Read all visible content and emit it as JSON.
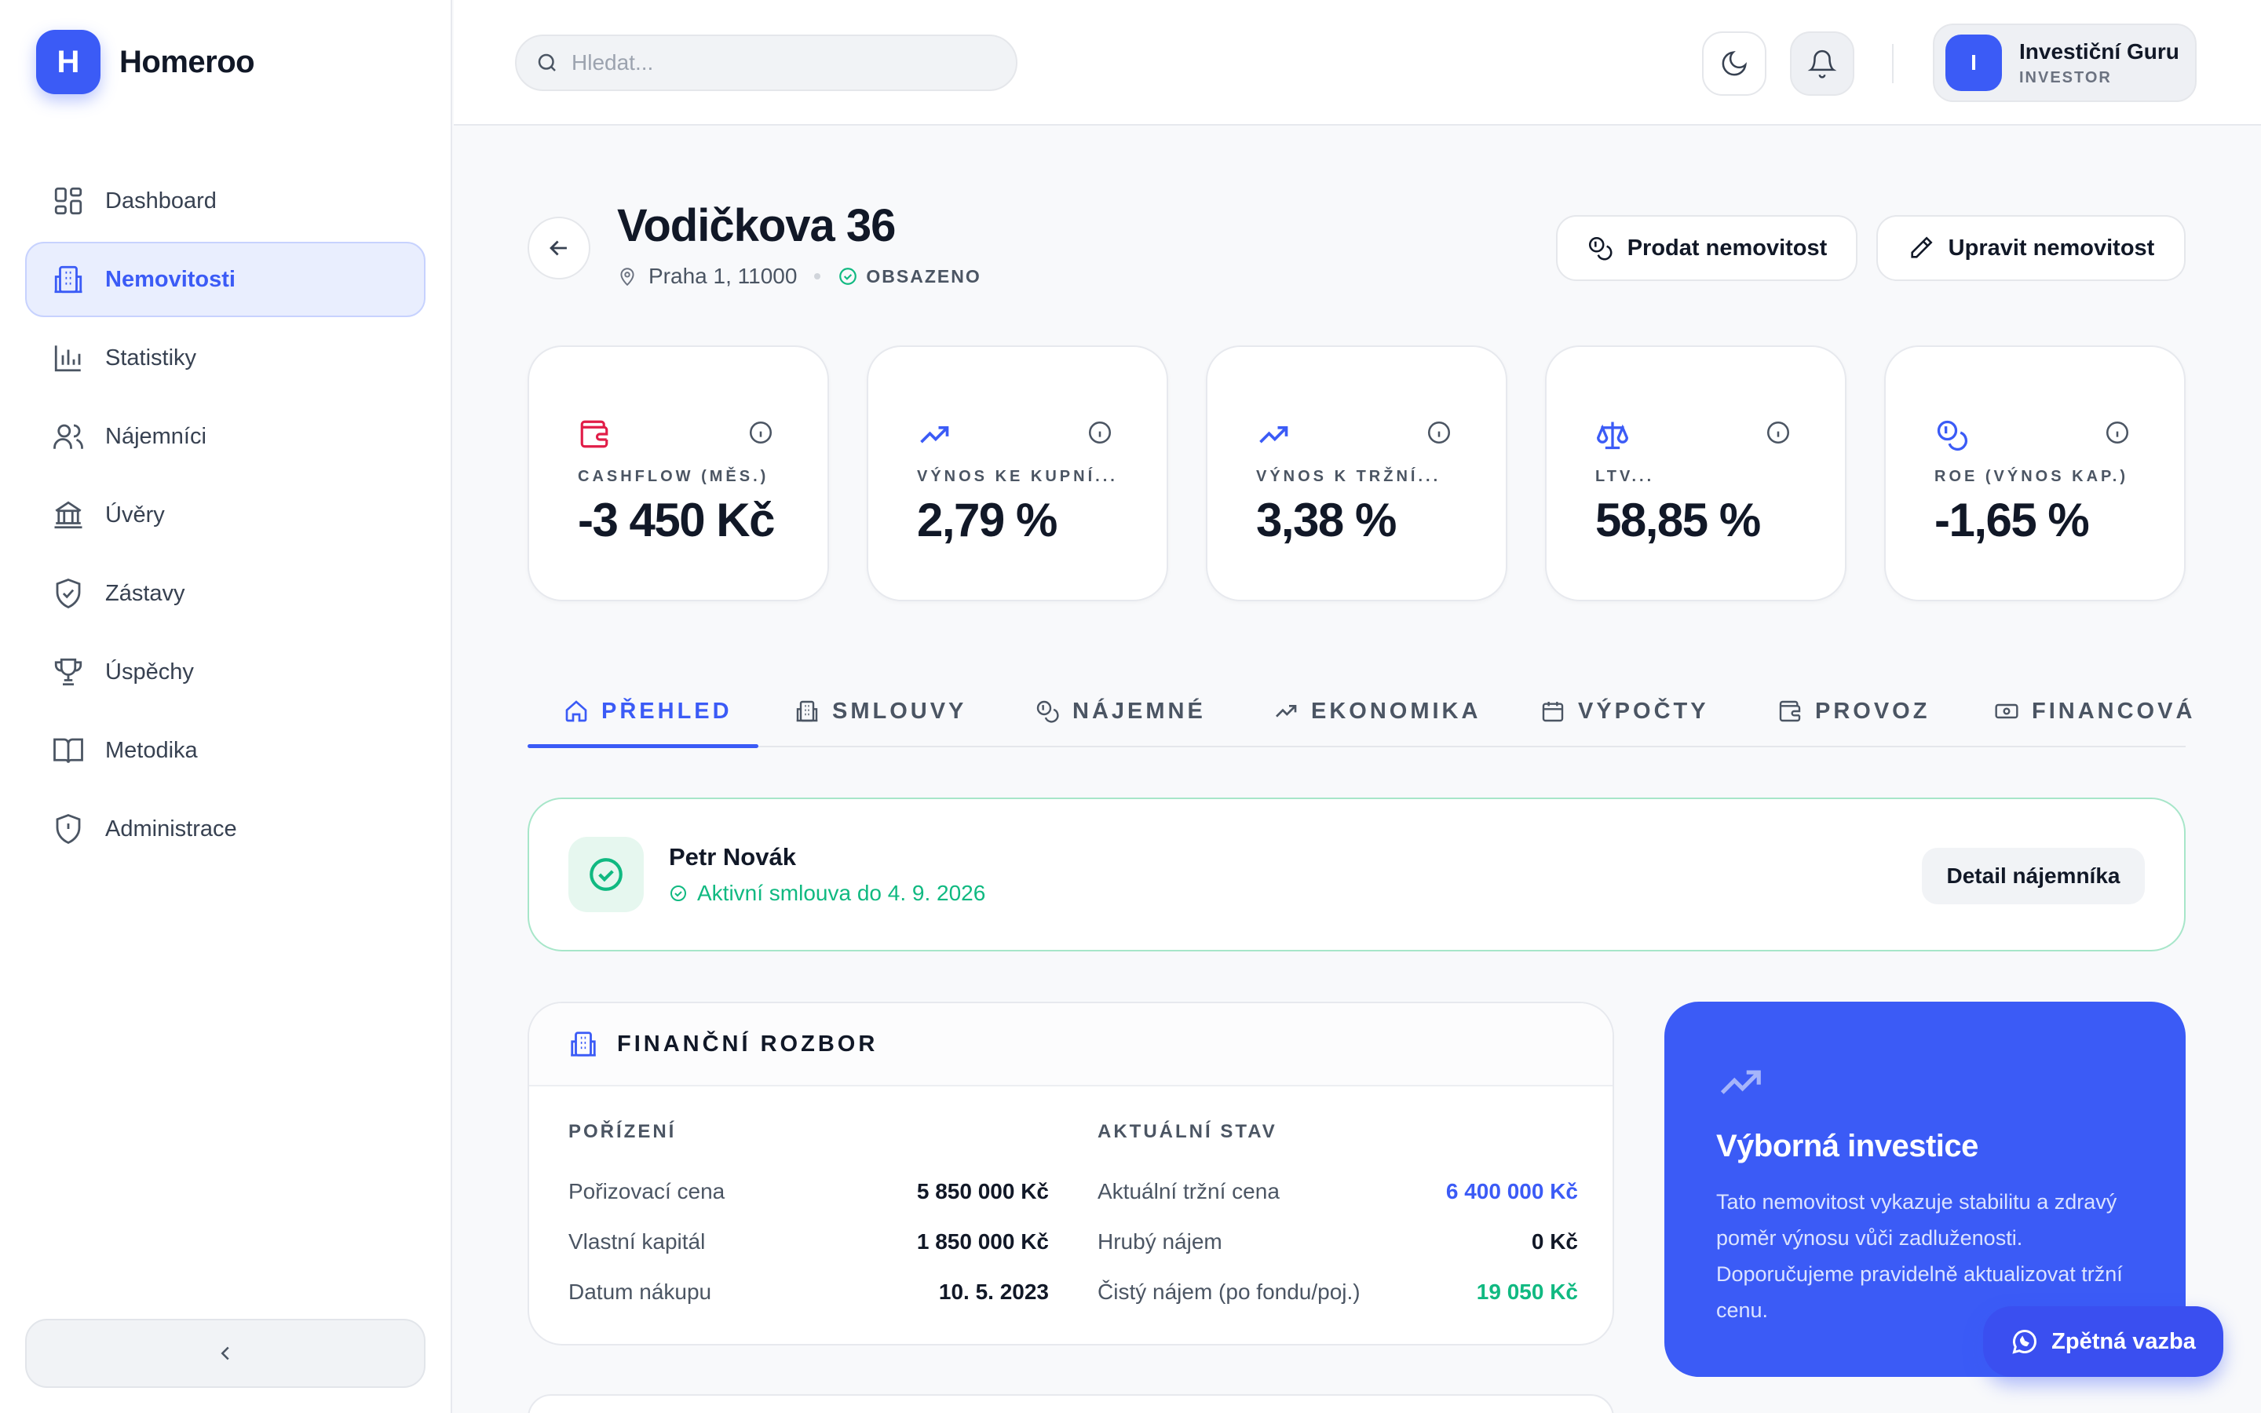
{
  "brand": {
    "logo_letter": "H",
    "name": "Homeroo"
  },
  "colors": {
    "accent": "#3b5bf6",
    "success": "#10b981",
    "danger": "#e11d48"
  },
  "sidebar": {
    "items": [
      {
        "label": "Dashboard",
        "icon": "grid-icon"
      },
      {
        "label": "Nemovitosti",
        "icon": "building-icon",
        "active": true
      },
      {
        "label": "Statistiky",
        "icon": "bar-chart-icon"
      },
      {
        "label": "Nájemníci",
        "icon": "users-icon"
      },
      {
        "label": "Úvěry",
        "icon": "bank-icon"
      },
      {
        "label": "Zástavy",
        "icon": "shield-check-icon"
      },
      {
        "label": "Úspěchy",
        "icon": "trophy-icon"
      },
      {
        "label": "Metodika",
        "icon": "book-icon"
      },
      {
        "label": "Administrace",
        "icon": "shield-alert-icon"
      }
    ]
  },
  "header": {
    "search_placeholder": "Hledat...",
    "user": {
      "initial": "I",
      "name": "Investiční Guru",
      "role": "INVESTOR"
    }
  },
  "property": {
    "title": "Vodičkova 36",
    "address": "Praha 1, 11000",
    "status": "OBSAZENO",
    "sell_label": "Prodat nemovitost",
    "edit_label": "Upravit nemovitost"
  },
  "kpis": [
    {
      "label": "CASHFLOW (MĚS.)",
      "value": "-3 450 Kč",
      "icon": "wallet-icon"
    },
    {
      "label": "VÝNOS KE KUPNÍ...",
      "value": "2,79 %",
      "icon": "trend-up-icon"
    },
    {
      "label": "VÝNOS K TRŽNÍ...",
      "value": "3,38 %",
      "icon": "trend-up-icon"
    },
    {
      "label": "LTV...",
      "value": "58,85 %",
      "icon": "scale-icon"
    },
    {
      "label": "ROE (VÝNOS KAP.)",
      "value": "-1,65 %",
      "icon": "coins-icon"
    }
  ],
  "tabs": [
    {
      "label": "PŘEHLED",
      "icon": "home-icon",
      "active": true
    },
    {
      "label": "SMLOUVY",
      "icon": "building-icon"
    },
    {
      "label": "NÁJEMNÉ",
      "icon": "coins-icon"
    },
    {
      "label": "EKONOMIKA",
      "icon": "trend-up-icon"
    },
    {
      "label": "VÝPOČTY",
      "icon": "calendar-icon"
    },
    {
      "label": "PROVOZ",
      "icon": "wallet-icon"
    },
    {
      "label": "FINANCOVÁ",
      "icon": "banknote-icon"
    }
  ],
  "tenant": {
    "name": "Petr Novák",
    "contract": "Aktivní smlouva do 4. 9. 2026",
    "detail_label": "Detail nájemníka"
  },
  "finance": {
    "title": "FINANČNÍ ROZBOR",
    "acquisition": {
      "heading": "POŘÍZENÍ",
      "rows": [
        {
          "label": "Pořizovací cena",
          "value": "5 850 000 Kč"
        },
        {
          "label": "Vlastní kapitál",
          "value": "1 850 000 Kč"
        },
        {
          "label": "Datum nákupu",
          "value": "10. 5. 2023"
        }
      ]
    },
    "current": {
      "heading": "AKTUÁLNÍ STAV",
      "rows": [
        {
          "label": "Aktuální tržní cena",
          "value": "6 400 000 Kč"
        },
        {
          "label": "Hrubý nájem",
          "value": "0 Kč"
        },
        {
          "label": "Čistý nájem (po fondu/poj.)",
          "value": "19 050 Kč"
        }
      ]
    }
  },
  "promo": {
    "title": "Výborná investice",
    "text": "Tato nemovitost vykazuje stabilitu a zdravý poměr výnosu vůči zadluženosti. Doporučujeme pravidelně aktualizovat tržní cenu."
  },
  "feedback": {
    "label": "Zpětná vazba"
  }
}
